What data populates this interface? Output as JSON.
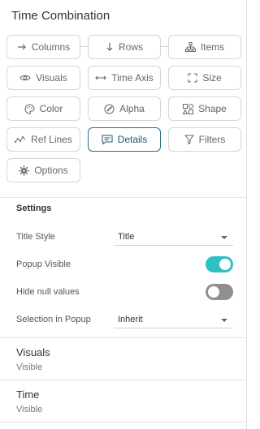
{
  "title": "Time Combination",
  "buttons": {
    "columns": "Columns",
    "rows": "Rows",
    "items": "Items",
    "visuals": "Visuals",
    "time_axis": "Time Axis",
    "size": "Size",
    "color": "Color",
    "alpha": "Alpha",
    "shape": "Shape",
    "ref_lines": "Ref Lines",
    "details": "Details",
    "filters": "Filters",
    "options": "Options"
  },
  "active_button": "details",
  "colors": {
    "accent": "#2a6e84",
    "toggle_on": "#2fbfc4",
    "toggle_off": "#8f8f8f"
  },
  "settings": {
    "heading": "Settings",
    "title_style_label": "Title Style",
    "title_style_value": "Title",
    "popup_visible_label": "Popup Visible",
    "popup_visible_on": true,
    "hide_null_label": "Hide null values",
    "hide_null_on": false,
    "selection_popup_label": "Selection in Popup",
    "selection_popup_value": "Inherit"
  },
  "detail_items": [
    {
      "title": "Visuals",
      "subtitle": "Visible"
    },
    {
      "title": "Time",
      "subtitle": "Visible"
    }
  ]
}
